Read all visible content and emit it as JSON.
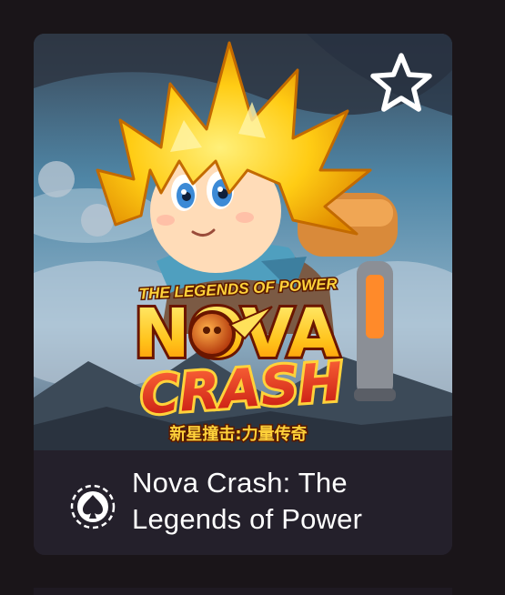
{
  "game": {
    "title": "Nova Crash: The Legends of Power",
    "art_subtitle": "THE LEGENDS OF POWER",
    "art_logo_line1": "NOVA",
    "art_logo_line2": "CRASH",
    "art_logo_chinese": "新星撞击:力量传奇"
  },
  "favorite": {
    "icon": "star-outline-icon",
    "favorited": false
  },
  "provider": {
    "icon": "spade-chip-icon"
  },
  "colors": {
    "page_background": "#1a1519",
    "card_footer": "#24202b",
    "title_text": "#ffffff",
    "logo_yellow": "#ffc21a",
    "logo_red": "#e8281e"
  }
}
